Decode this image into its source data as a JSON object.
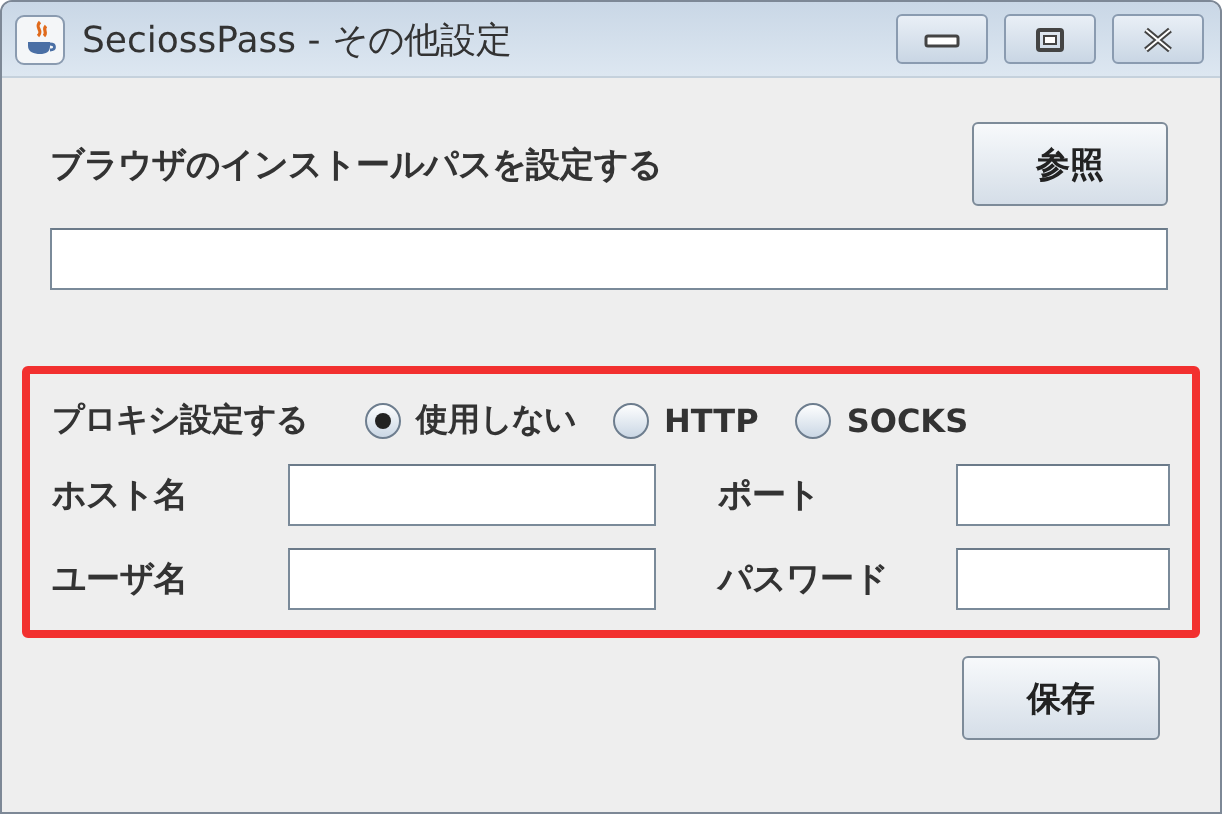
{
  "window": {
    "title": "SeciossPass - その他設定"
  },
  "browser_path": {
    "label": "ブラウザのインストールパスを設定する",
    "browse_button": "参照"
  },
  "proxy": {
    "highlighted": true,
    "label": "プロキシ設定する",
    "options": [
      {
        "label": "使用しない",
        "selected": true
      },
      {
        "label": "HTTP",
        "selected": false
      },
      {
        "label": "SOCKS",
        "selected": false
      }
    ],
    "fields": [
      {
        "label": "ホスト名"
      },
      {
        "label": "ポート"
      },
      {
        "label": "ユーザ名"
      },
      {
        "label": "パスワード"
      }
    ]
  },
  "buttons": [
    "保存"
  ]
}
